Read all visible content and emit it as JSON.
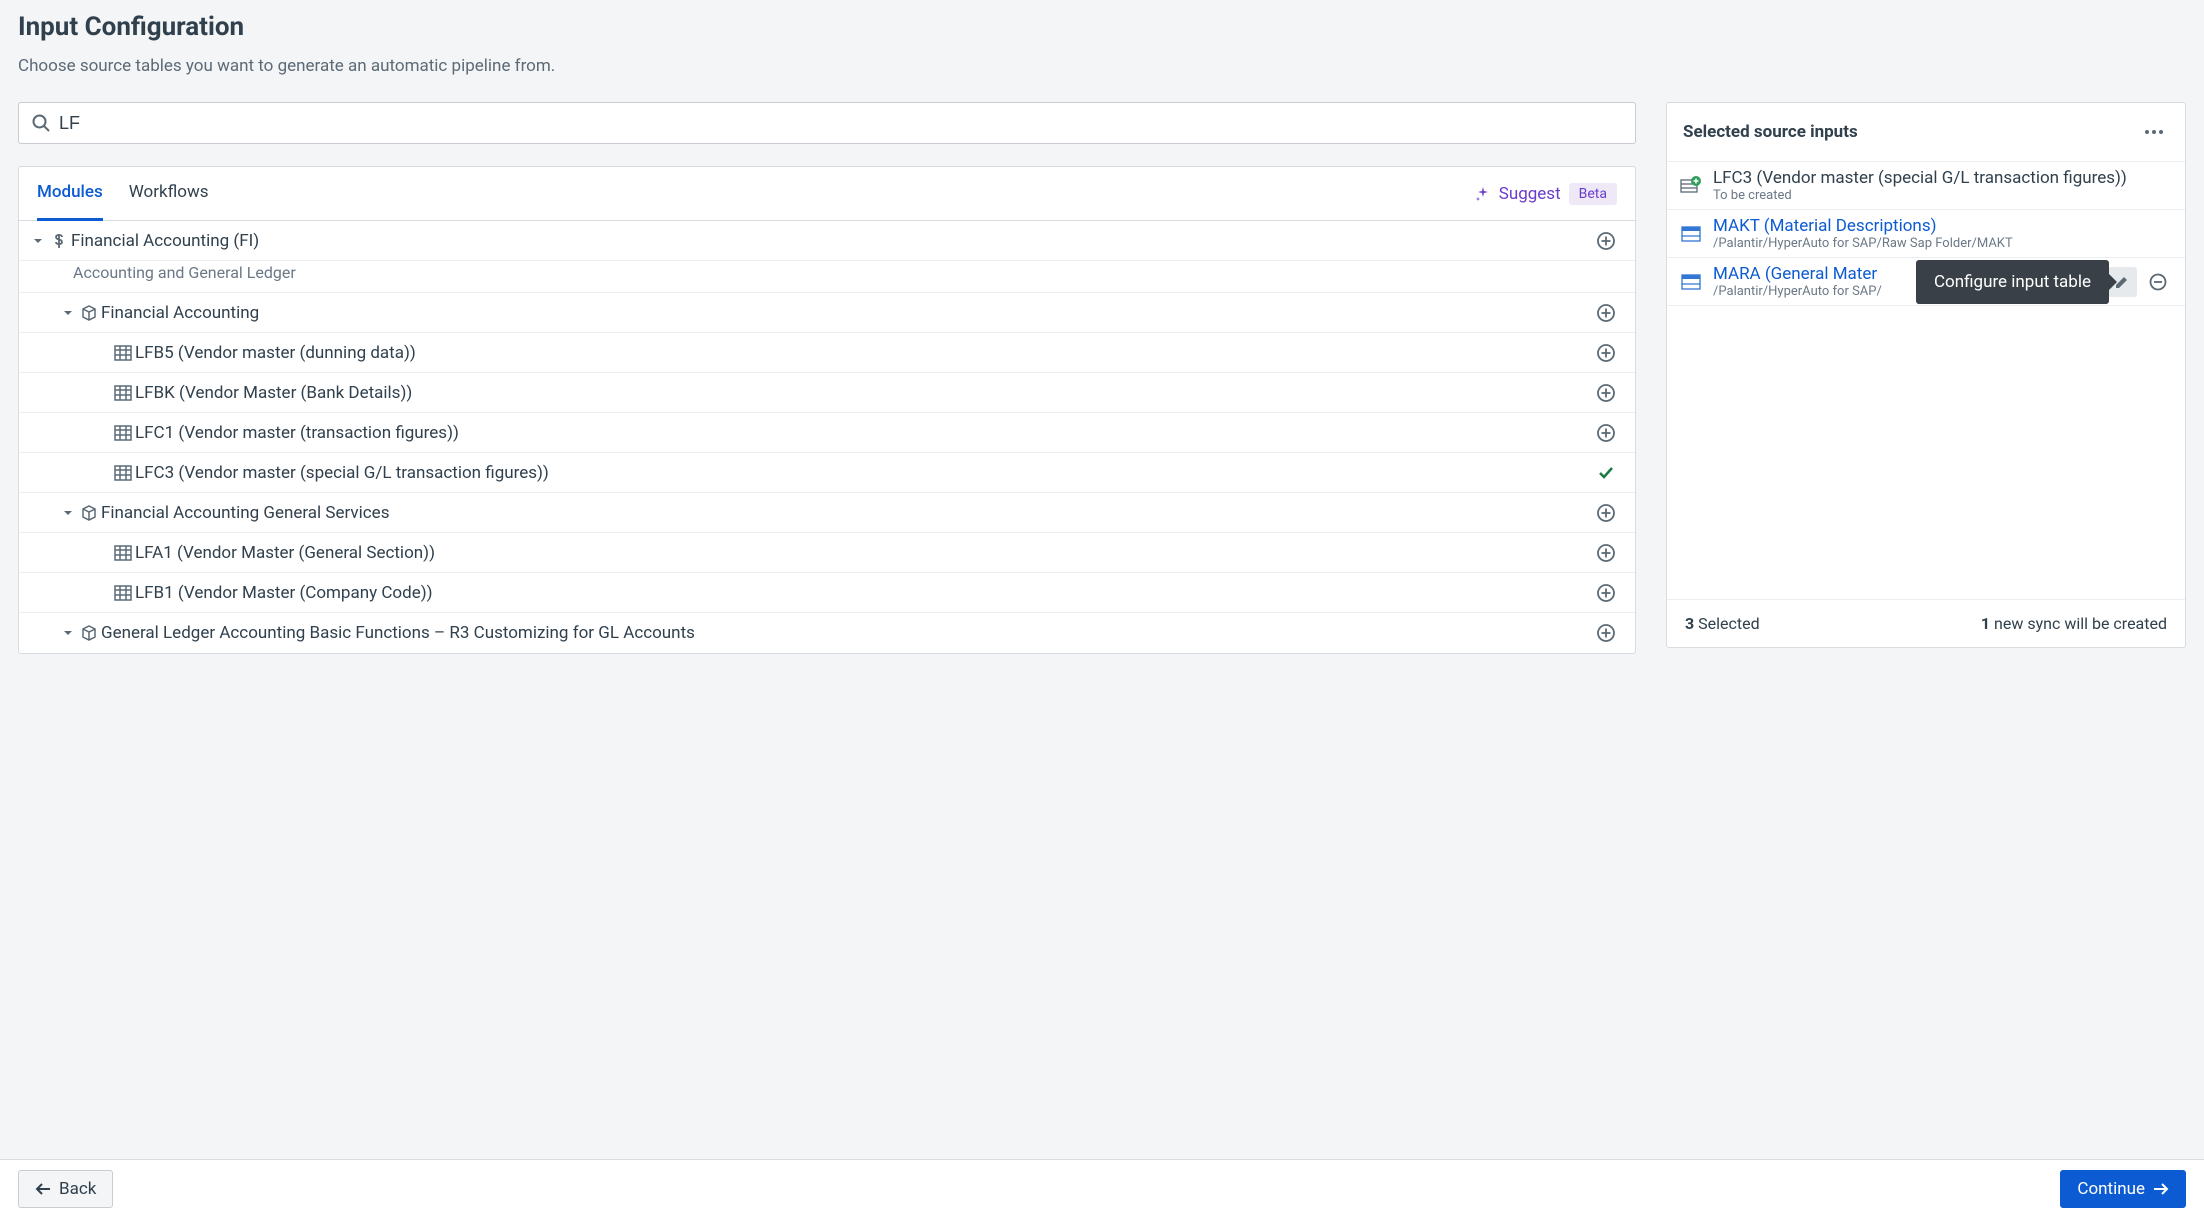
{
  "page": {
    "title": "Input Configuration",
    "subtitle": "Choose source tables you want to generate an automatic pipeline from."
  },
  "search": {
    "value": "LF"
  },
  "tabs": {
    "modules": "Modules",
    "workflows": "Workflows"
  },
  "suggest": {
    "label": "Suggest",
    "badge": "Beta"
  },
  "tree": {
    "fi": {
      "label": "Financial Accounting (FI)",
      "subtitle": "Accounting and General Ledger"
    },
    "fa": {
      "label": "Financial Accounting"
    },
    "lfb5": "LFB5 (Vendor master (dunning data))",
    "lfbk": "LFBK (Vendor Master (Bank Details))",
    "lfc1": "LFC1 (Vendor master (transaction figures))",
    "lfc3": "LFC3 (Vendor master (special G/L transaction figures))",
    "fags": "Financial Accounting General Services",
    "lfa1": "LFA1 (Vendor Master (General Section))",
    "lfb1": "LFB1 (Vendor Master (Company Code))",
    "gl": "General Ledger Accounting Basic Functions – R3 Customizing for GL Accounts"
  },
  "selected": {
    "header": "Selected source inputs",
    "items": [
      {
        "title": "LFC3 (Vendor master (special G/L transaction figures))",
        "path": "To be created",
        "new": true
      },
      {
        "title": "MAKT (Material Descriptions)",
        "path": "/Palantir/HyperAuto for SAP/Raw Sap Folder/MAKT",
        "new": false
      },
      {
        "title": "MARA (General Mater",
        "path": "/Palantir/HyperAuto for SAP/",
        "new": false,
        "active": true
      }
    ],
    "footer_left_count": "3",
    "footer_left_label": " Selected",
    "footer_right_count": "1",
    "footer_right_label": " new sync will be created"
  },
  "tooltip": "Configure input table",
  "buttons": {
    "back": "Back",
    "continue": "Continue"
  }
}
